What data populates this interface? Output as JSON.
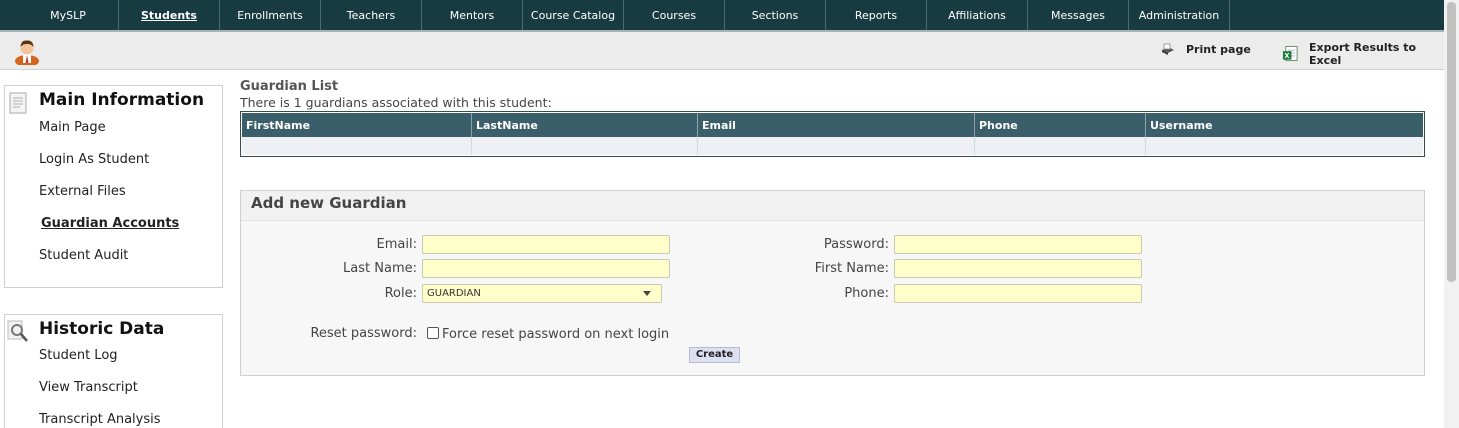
{
  "nav": {
    "items": [
      {
        "label": "MySLP"
      },
      {
        "label": "Students"
      },
      {
        "label": "Enrollments"
      },
      {
        "label": "Teachers"
      },
      {
        "label": "Mentors"
      },
      {
        "label": "Course Catalog"
      },
      {
        "label": "Courses"
      },
      {
        "label": "Sections"
      },
      {
        "label": "Reports"
      },
      {
        "label": "Affiliations"
      },
      {
        "label": "Messages"
      },
      {
        "label": "Administration"
      }
    ],
    "active": "Students",
    "bg_color": "#173b41"
  },
  "toolbar": {
    "print_label": "Print page",
    "export_label": "Export Results to Excel"
  },
  "sidebar": {
    "main": {
      "title": "Main Information",
      "items": [
        {
          "label": "Main Page"
        },
        {
          "label": "Login As Student"
        },
        {
          "label": "External Files"
        },
        {
          "label": "Guardian Accounts"
        },
        {
          "label": "Student Audit"
        }
      ],
      "current": "Guardian Accounts"
    },
    "historic": {
      "title": "Historic Data",
      "items": [
        {
          "label": "Student Log"
        },
        {
          "label": "View Transcript"
        },
        {
          "label": "Transcript Analysis"
        }
      ]
    }
  },
  "guardian_list": {
    "title": "Guardian List",
    "subtitle": "There is 1 guardians associated with this student:",
    "columns": [
      "FirstName",
      "LastName",
      "Email",
      "Phone",
      "Username"
    ],
    "rows": [
      [
        "",
        "",
        "",
        "",
        ""
      ]
    ],
    "header_color": "#3a5e6a"
  },
  "form": {
    "title": "Add new Guardian",
    "email_label": "Email:",
    "password_label": "Password:",
    "lastname_label": "Last Name:",
    "firstname_label": "First Name:",
    "role_label": "Role:",
    "phone_label": "Phone:",
    "role_value": "GUARDIAN",
    "email_value": "",
    "password_value": "",
    "lastname_value": "",
    "firstname_value": "",
    "phone_value": "",
    "reset_label": "Reset password:",
    "reset_checkbox_label": "Force reset password on next login",
    "reset_checked": false,
    "create_label": "Create",
    "input_color": "#ffffcc"
  }
}
